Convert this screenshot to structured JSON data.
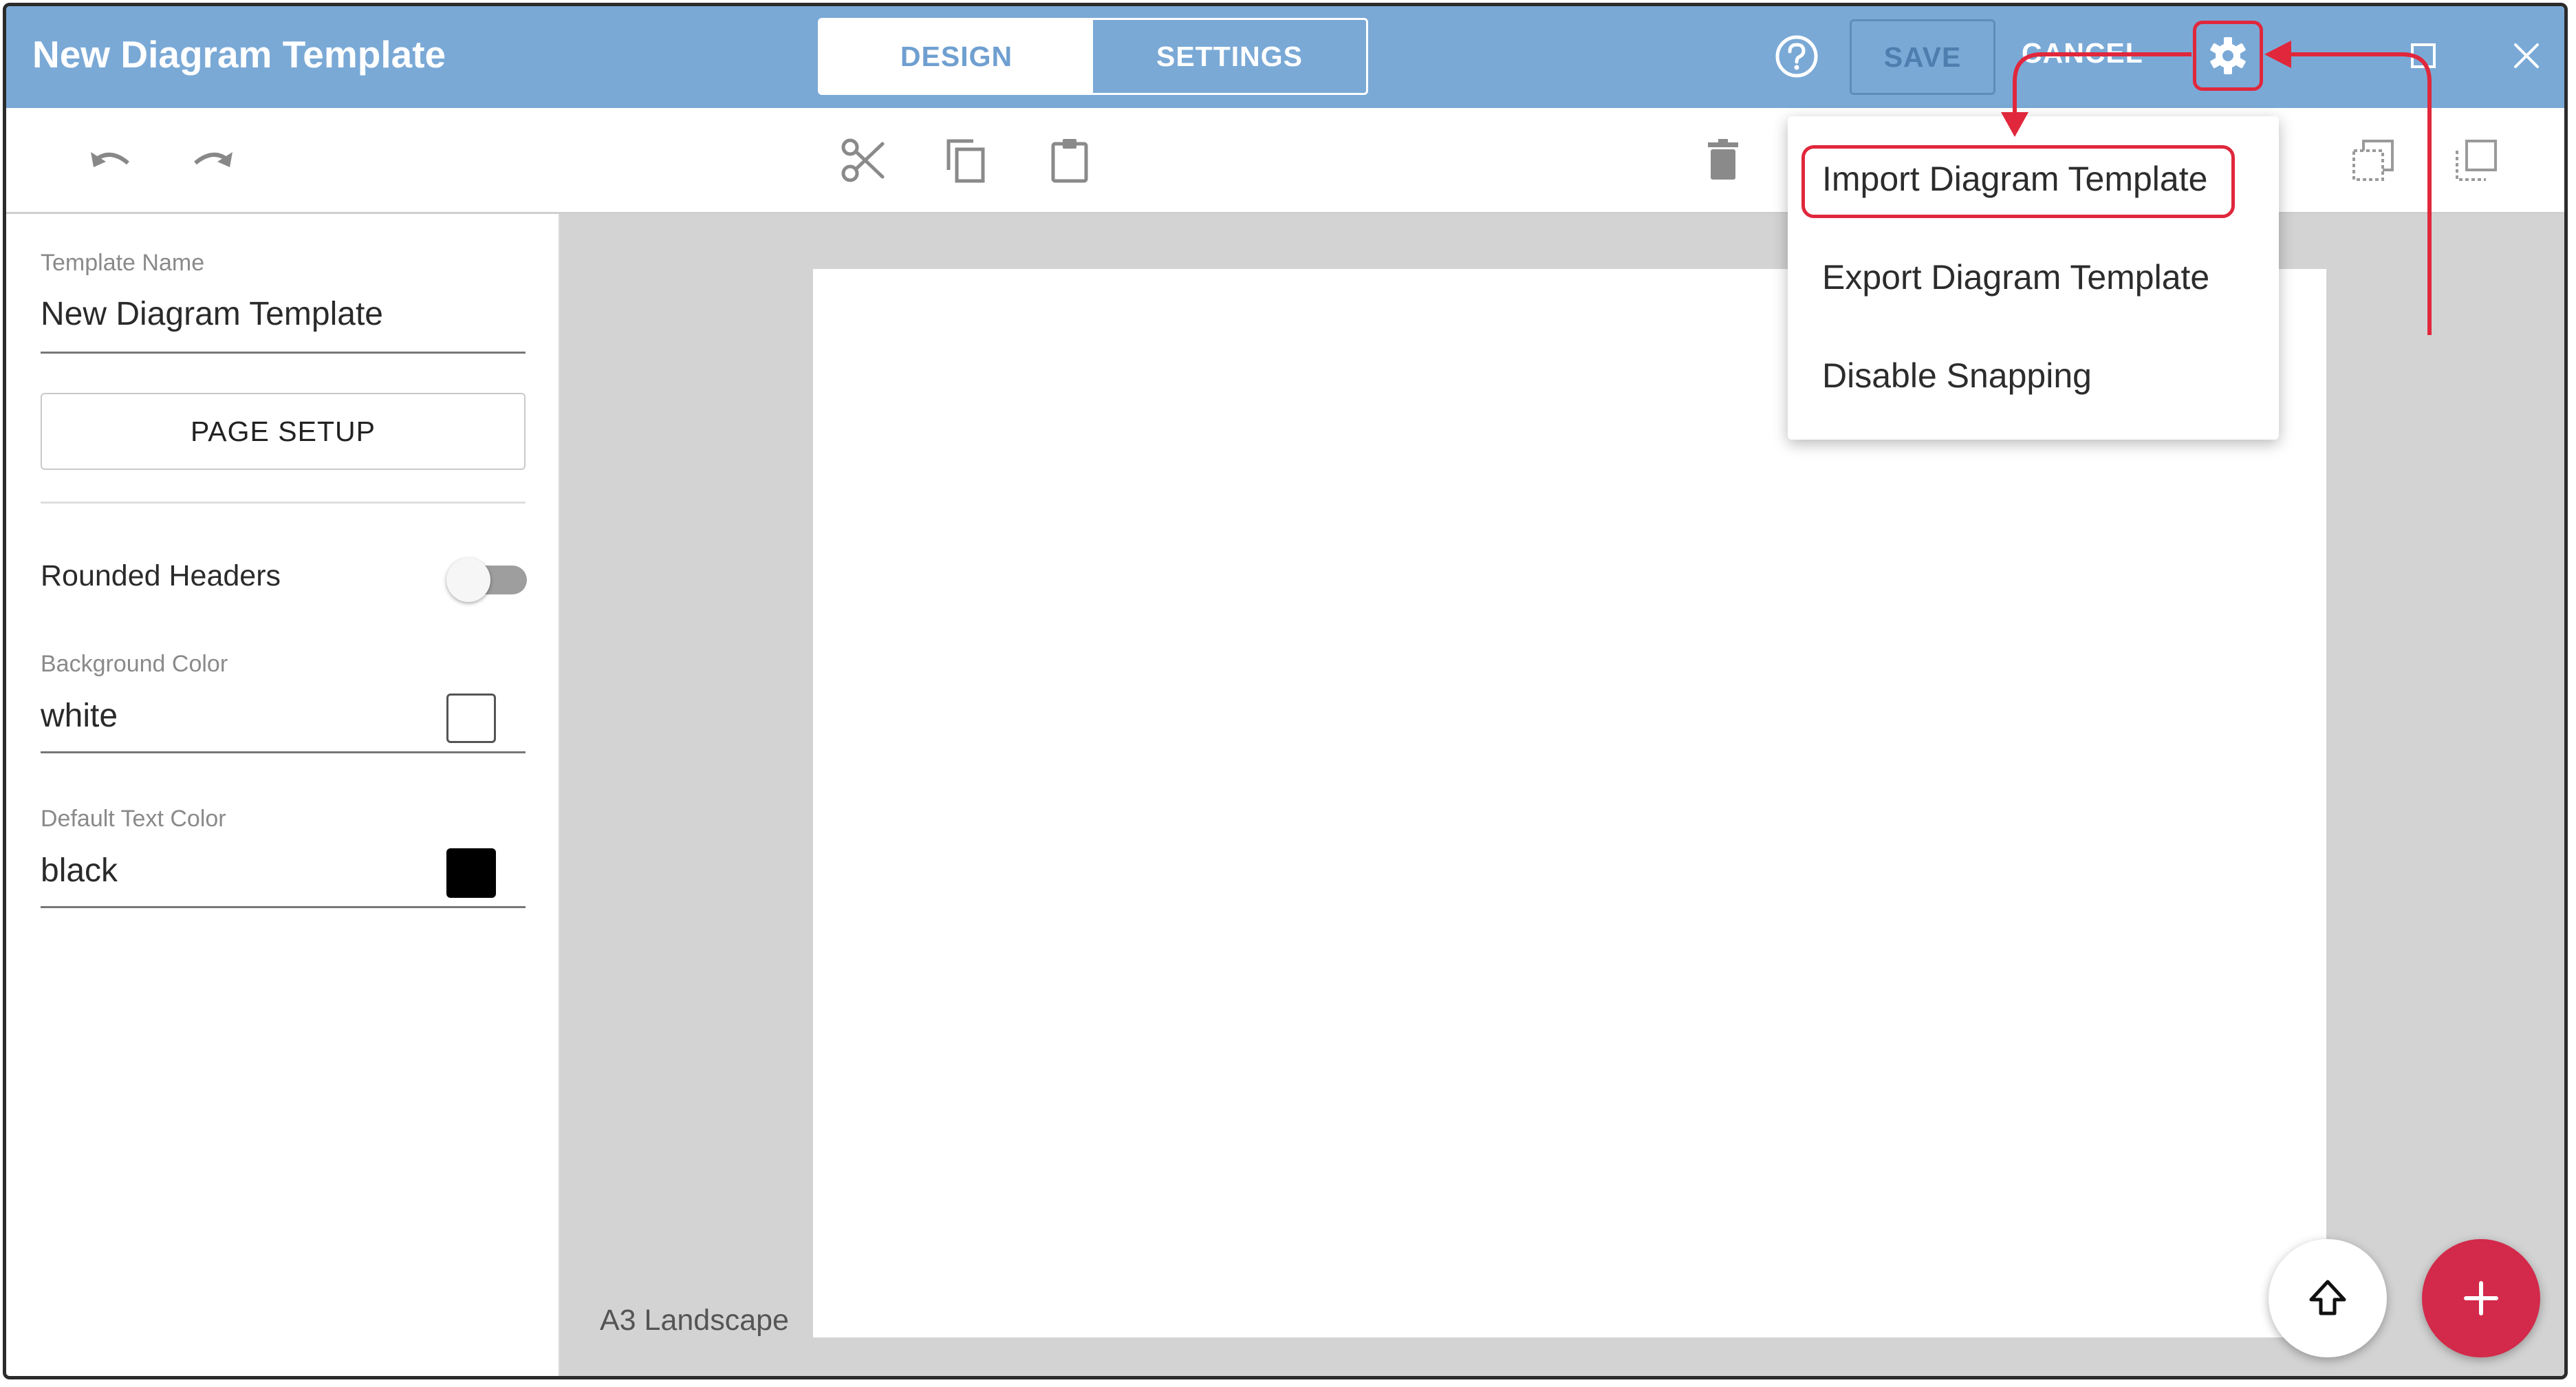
{
  "window": {
    "title": "New Diagram Template"
  },
  "header": {
    "tabs": [
      {
        "label": "DESIGN"
      },
      {
        "label": "SETTINGS"
      }
    ],
    "save_label": "SAVE",
    "cancel_label": "CANCEL"
  },
  "icons": {
    "help": "help-circle-icon",
    "settings": "gear-icon",
    "maximize": "maximize-icon",
    "close": "close-icon",
    "undo": "undo-icon",
    "redo": "redo-icon",
    "cut": "scissors-icon",
    "copy": "copy-icon",
    "paste": "clipboard-icon",
    "delete": "trash-icon",
    "send_back": "send-to-back-icon",
    "bring_front": "bring-to-front-icon",
    "scroll_top": "arrow-up-icon",
    "add": "plus-icon"
  },
  "settings_menu": {
    "items": [
      {
        "label": "Import Diagram Template"
      },
      {
        "label": "Export Diagram Template"
      },
      {
        "label": "Disable Snapping"
      }
    ]
  },
  "sidebar": {
    "template_name": {
      "label": "Template Name",
      "value": "New Diagram Template"
    },
    "page_setup_label": "PAGE SETUP",
    "rounded_headers": {
      "label": "Rounded Headers",
      "enabled": false
    },
    "background_color": {
      "label": "Background Color",
      "value": "white",
      "swatch": "#ffffff"
    },
    "default_text_color": {
      "label": "Default Text Color",
      "value": "black",
      "swatch": "#000000"
    }
  },
  "canvas": {
    "page_size_label": "A3 Landscape"
  },
  "colors": {
    "titlebar": "#7aa9d6",
    "accent_red": "#e0273c",
    "fab": "#d3294a",
    "canvas_bg": "#d3d3d3"
  }
}
